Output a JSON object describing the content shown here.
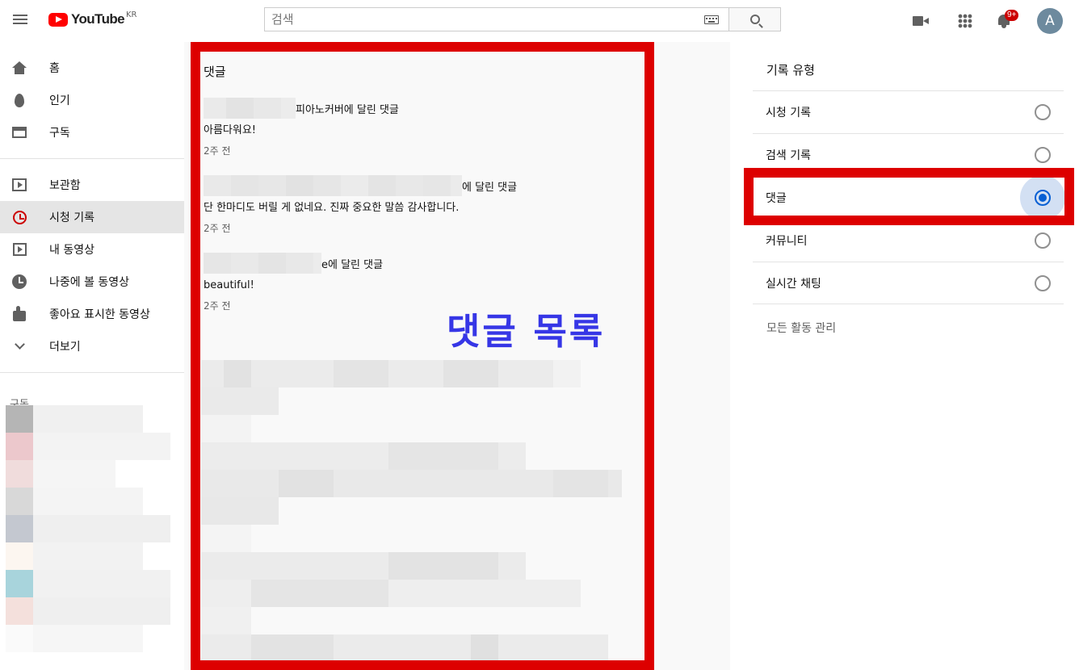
{
  "header": {
    "logo_text": "YouTube",
    "logo_country": "KR",
    "search_placeholder": "검색",
    "notification_count": "9+",
    "avatar_letter": "A"
  },
  "sidebar": {
    "items": [
      {
        "label": "홈",
        "icon": "home-icon"
      },
      {
        "label": "인기",
        "icon": "fire-icon"
      },
      {
        "label": "구독",
        "icon": "subscriptions-icon"
      },
      {
        "label": "보관함",
        "icon": "library-icon"
      },
      {
        "label": "시청 기록",
        "icon": "history-icon",
        "active": true
      },
      {
        "label": "내 동영상",
        "icon": "my-videos-icon"
      },
      {
        "label": "나중에 볼 동영상",
        "icon": "watch-later-icon"
      },
      {
        "label": "좋아요 표시한 동영상",
        "icon": "like-icon"
      },
      {
        "label": "더보기",
        "icon": "chevron-down-icon"
      }
    ],
    "subscriptions_title": "구독"
  },
  "comments": {
    "heading": "댓글",
    "items": [
      {
        "target": "피아노커버에 달린 댓글",
        "text": "아름다워요!",
        "time": "2주 전"
      },
      {
        "target": "에 달린 댓글",
        "text": "단 한마디도 버릴 게 없네요. 진짜 중요한 말씀 감사합니다.",
        "time": "2주 전"
      },
      {
        "target": "e에 달린 댓글",
        "text": "beautiful!",
        "time": "2주 전"
      }
    ],
    "overlay_label": "댓글 목록"
  },
  "history_type": {
    "title": "기록 유형",
    "options": [
      {
        "label": "시청 기록",
        "selected": false
      },
      {
        "label": "검색 기록",
        "selected": false
      },
      {
        "label": "댓글",
        "selected": true
      },
      {
        "label": "커뮤니티",
        "selected": false
      },
      {
        "label": "실시간 채팅",
        "selected": false
      }
    ],
    "manage_label": "모든 활동 관리"
  },
  "colors": {
    "brand_red": "#ff0000",
    "highlight_red": "#dd0000",
    "overlay_blue": "#3636e6",
    "radio_blue": "#065fd4"
  }
}
